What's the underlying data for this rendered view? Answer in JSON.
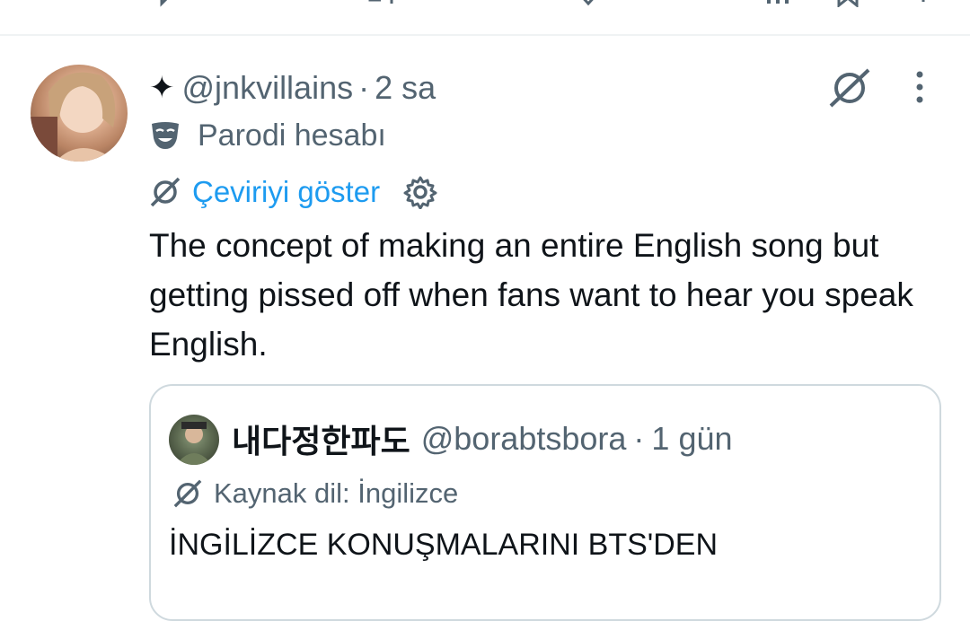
{
  "tweet": {
    "author_prefix": "✦",
    "handle": "@jnkvillains",
    "separator": "·",
    "time": "2 sa",
    "parody_label": "Parodi hesabı",
    "translate_label": "Çeviriyi göster",
    "text": "The concept of making an entire English song but getting pissed off when fans want to hear you speak English."
  },
  "quote": {
    "name": "내다정한파도",
    "handle": "@borabtsbora",
    "separator": "·",
    "time": "1 gün",
    "source_language": "Kaynak dil: İngilizce",
    "text": "İNGİLİZCE KONUŞMALARINI BTS'DEN"
  },
  "icons": {
    "top_row": [
      "reply-icon",
      "retweet-icon",
      "like-icon",
      "views-icon",
      "bookmark-icon",
      "share-icon"
    ],
    "parody": "mask-icon",
    "grok": "grok-icon",
    "more": "more-vertical-icon",
    "translate": "translate-icon",
    "settings": "gear-icon"
  },
  "colors": {
    "link": "#1d9bf0",
    "secondary": "#536471",
    "border": "#cfd9de"
  }
}
